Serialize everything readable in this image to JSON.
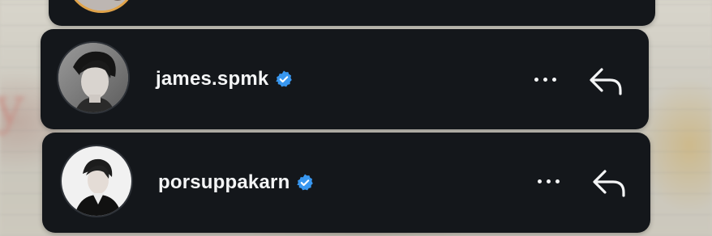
{
  "notifications": [
    {
      "username": "james.spmk",
      "verified": true,
      "avatar": "profile-photo",
      "more_icon": "more-horizontal-icon",
      "reply_icon": "reply-arrow-icon"
    },
    {
      "username": "porsuppakarn",
      "verified": true,
      "avatar": "profile-photo",
      "more_icon": "more-horizontal-icon",
      "reply_icon": "reply-arrow-icon"
    }
  ],
  "colors": {
    "card_bg": "#14171b",
    "text": "#f4f5f6",
    "verified_badge": "#3897f0",
    "story_ring": "#e0a34a"
  }
}
